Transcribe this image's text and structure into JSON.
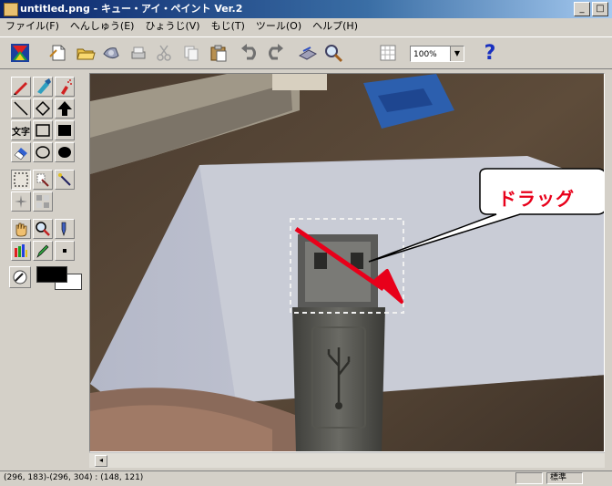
{
  "window": {
    "title": "untitled.png - キュー・アイ・ペイント Ver.2",
    "min_symbol": "_",
    "max_symbol": "□",
    "close_symbol": "×"
  },
  "menu": [
    "ファイル(F)",
    "へんしゅう(E)",
    "ひょうじ(V)",
    "もじ(T)",
    "ツール(O)",
    "ヘルプ(H)"
  ],
  "toolbar": {
    "icons": [
      "logo-icon",
      "new-file-icon",
      "open-folder-icon",
      "save-icon",
      "print-icon",
      "cut-icon",
      "copy-icon",
      "paste-icon",
      "undo-icon",
      "redo-icon",
      "scanner-icon",
      "zoom-icon",
      "grid-icon"
    ],
    "zoom_value": "100%",
    "help_symbol": "?"
  },
  "toolbox": {
    "text_tool_label": "文字",
    "fg_color": "#000000",
    "bg_color": "#ffffff"
  },
  "canvas": {
    "callout_text": "ドラッグ",
    "accent_color": "#e8001a"
  },
  "status": {
    "coords": "(296, 183)-(296, 304) : (148, 121)",
    "right_label": "標準"
  }
}
